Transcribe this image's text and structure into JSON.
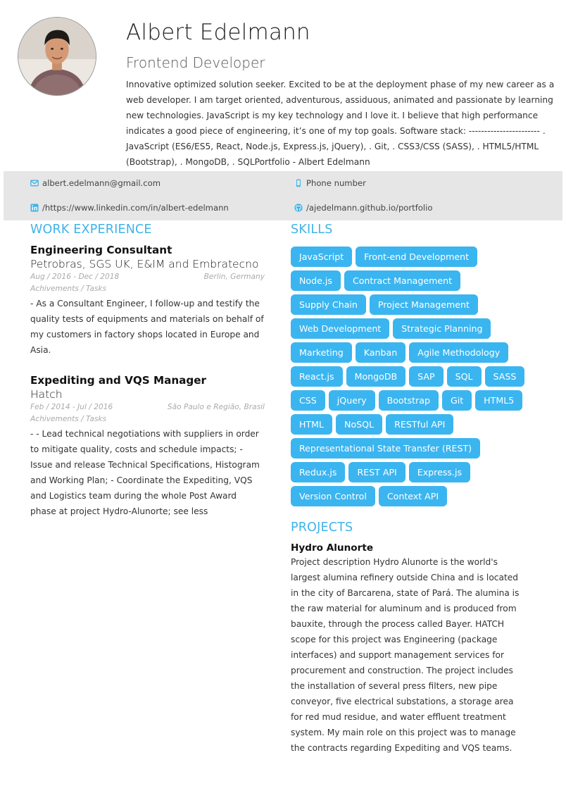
{
  "header": {
    "name": "Albert Edelmann",
    "role": "Frontend Developer",
    "summary": "Innovative optimized solution seeker. Excited to be at the deployment phase of my new career as a web developer. I am target oriented, adventurous, assiduous, animated and passionate by learning new technologies. JavaScript is my key technology and I love it. I believe that high performance indicates a good piece of engineering, it’s one of my top goals. Software stack: ----------------------- . JavaScript (ES6/ES5, React, Node.js, Express.js, jQuery), . Git, . CSS3/CSS (SASS), . HTML5/HTML (Bootstrap), . MongoDB, . SQLPortfolio - Albert Edelmann"
  },
  "contact": {
    "email": "albert.edelmann@gmail.com",
    "phone": "Phone number",
    "linkedin": "/https://www.linkedin.com/in/albert-edelmann",
    "github": "/ajedelmann.github.io/portfolio"
  },
  "sections": {
    "work": "WORK EXPERIENCE",
    "skills": "SKILLS",
    "projects": "PROJECTS"
  },
  "jobs": [
    {
      "title": "Engineering Consultant",
      "company": "Petrobras, SGS UK, E&IM and Embratecno",
      "dates": "Aug  /  2016  -  Dec  /  2018",
      "location": "Berlin, Germany",
      "sub": "Achivements / Tasks",
      "desc": "- As a Consultant Engineer, I follow-up and testify the quality tests of equipments and materials on behalf of my customers in factory shops located in Europe and Asia."
    },
    {
      "title": "Expediting and VQS Manager",
      "company": "Hatch",
      "dates": "Feb  /  2014  -  Jul  /  2016",
      "location": "São Paulo e Região, Brasil",
      "sub": "Achivements / Tasks",
      "desc": "- - Lead technical negotiations with suppliers in order to mitigate quality, costs and schedule impacts; - Issue and release Technical Specifications, Histogram and Working Plan; - Coordinate the Expediting, VQS and Logistics team during the whole Post Award phase at project Hydro-Alunorte; see less"
    }
  ],
  "skills": [
    "JavaScript",
    "Front-end Development",
    "Node.js",
    "Contract Management",
    "Supply Chain",
    "Project Management",
    "Web Development",
    "Strategic Planning",
    "Marketing",
    "Kanban",
    "Agile Methodology",
    "React.js",
    "MongoDB",
    "SAP",
    "SQL",
    "SASS",
    "CSS",
    "jQuery",
    "Bootstrap",
    "Git",
    "HTML5",
    "HTML",
    "NoSQL",
    "RESTful API",
    "Representational State Transfer (REST)",
    "Redux.js",
    "REST API",
    "Express.js",
    "Version Control",
    "Context API"
  ],
  "project": {
    "title": "Hydro Alunorte",
    "desc": "Project description Hydro Alunorte is the world's largest alumina refinery outside China and is located in the city of Barcarena, state of Pará. The alumina is the raw material for aluminum and is produced from bauxite, through the process called Bayer. HATCH scope for this project was Engineering (package interfaces) and support management services for procurement and construction. The project includes the installation of several press filters, new pipe conveyor, five electrical substations, a storage area for red mud residue, and water effluent treatment system. My main role on this project was to manage the contracts regarding Expediting and VQS teams."
  },
  "colors": {
    "accent": "#3fb3e8",
    "skill_bg": "#3bb5f0",
    "contact_bar": "#e6e6e6"
  }
}
